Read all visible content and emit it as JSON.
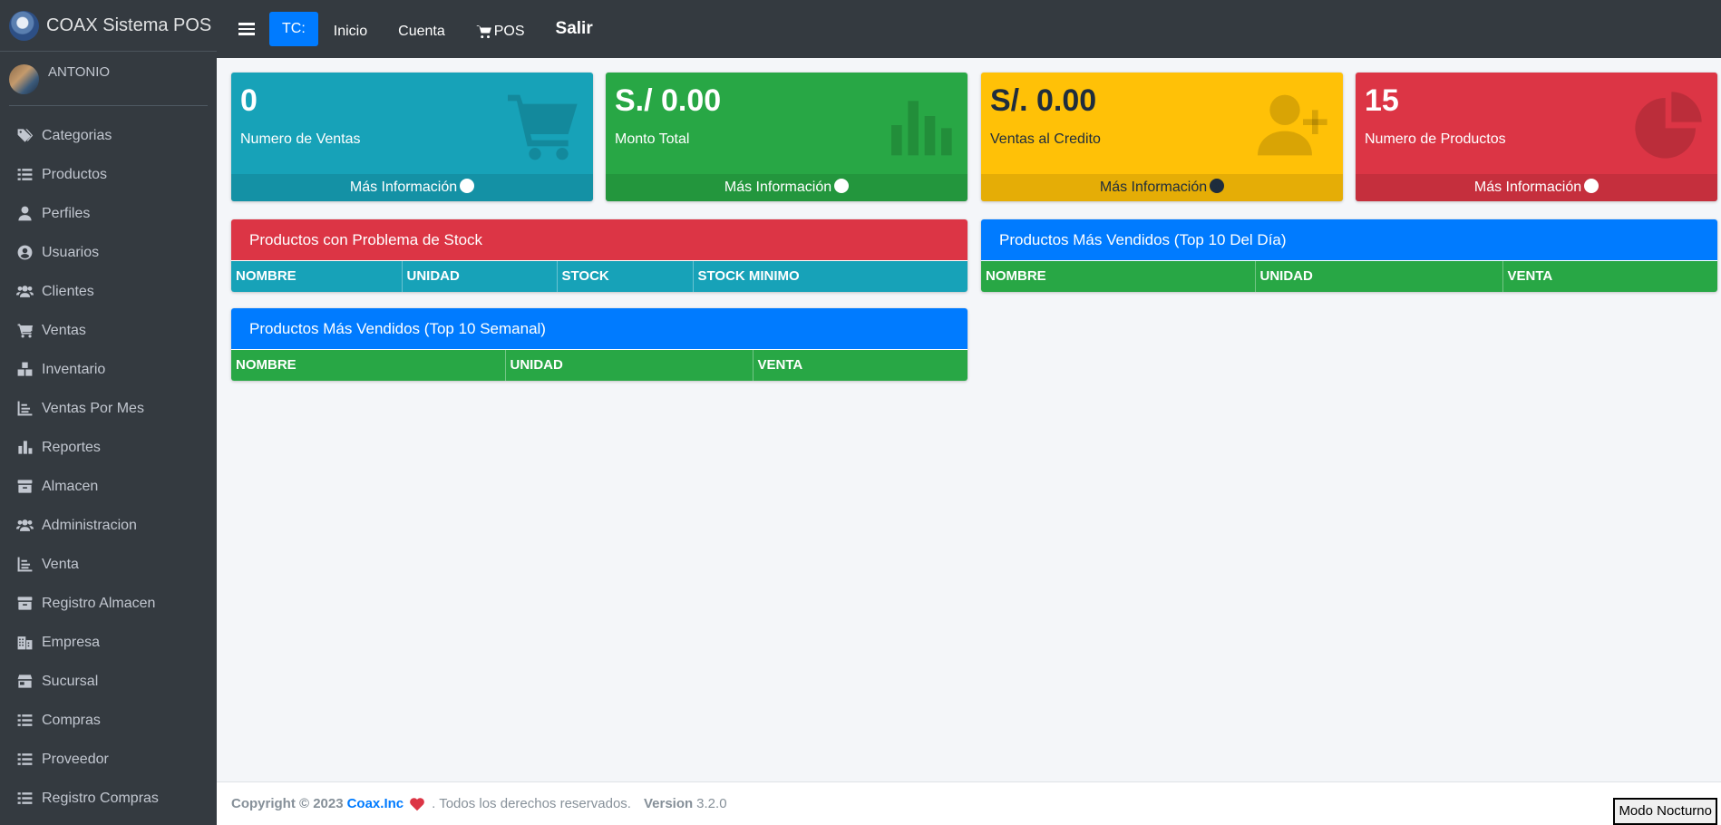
{
  "brand": {
    "name": "COAX Sistema POS",
    "logo_icon": "coax-logo"
  },
  "user": {
    "name": "ANTONIO"
  },
  "sidebar": {
    "items": [
      {
        "label": "Categorias",
        "icon": "tags-icon"
      },
      {
        "label": "Productos",
        "icon": "list-icon"
      },
      {
        "label": "Perfiles",
        "icon": "user-tie-icon"
      },
      {
        "label": "Usuarios",
        "icon": "user-circle-icon"
      },
      {
        "label": "Clientes",
        "icon": "users-icon"
      },
      {
        "label": "Ventas",
        "icon": "cart-plus-icon"
      },
      {
        "label": "Inventario",
        "icon": "cubes-icon"
      },
      {
        "label": "Ventas Por Mes",
        "icon": "chart-line-icon"
      },
      {
        "label": "Reportes",
        "icon": "chart-bar-icon"
      },
      {
        "label": "Almacen",
        "icon": "archive-icon"
      },
      {
        "label": "Administracion",
        "icon": "users-cog-icon"
      },
      {
        "label": "Venta",
        "icon": "chart-line-icon"
      },
      {
        "label": "Registro Almacen",
        "icon": "archive-icon"
      },
      {
        "label": "Empresa",
        "icon": "building-icon"
      },
      {
        "label": "Sucursal",
        "icon": "store-icon"
      },
      {
        "label": "Compras",
        "icon": "list-icon"
      },
      {
        "label": "Proveedor",
        "icon": "list-icon"
      },
      {
        "label": "Registro Compras",
        "icon": "list-icon"
      }
    ]
  },
  "navbar": {
    "tc_label": "TC:",
    "inicio": "Inicio",
    "cuenta": "Cuenta",
    "pos": "POS",
    "salir": "Salir"
  },
  "info_boxes": [
    {
      "value": "0",
      "label": "Numero de Ventas",
      "link": "Más Información",
      "icon": "shopping-cart-icon",
      "color": "#17a2b8"
    },
    {
      "value": "S./ 0.00",
      "label": "Monto Total",
      "link": "Más Información",
      "icon": "bar-chart-icon",
      "color": "#28a745"
    },
    {
      "value": "S/. 0.00",
      "label": "Ventas al Credito",
      "link": "Más Información",
      "icon": "user-plus-icon",
      "color": "#ffc107"
    },
    {
      "value": "15",
      "label": "Numero de Productos",
      "link": "Más Información",
      "icon": "pie-chart-icon",
      "color": "#dc3545"
    }
  ],
  "cards": {
    "stock": {
      "title": "Productos con Problema de Stock",
      "columns": [
        "NOMBRE",
        "UNIDAD",
        "STOCK",
        "STOCK MINIMO"
      ]
    },
    "top_day": {
      "title": "Productos Más Vendidos (Top 10 Del Día)",
      "columns": [
        "NOMBRE",
        "UNIDAD",
        "VENTA"
      ]
    },
    "top_week": {
      "title": "Productos Más Vendidos (Top 10 Semanal)",
      "columns": [
        "NOMBRE",
        "UNIDAD",
        "VENTA"
      ]
    }
  },
  "footer": {
    "copyright": "Copyright © 2023",
    "company": "Coax.Inc",
    "rights": ". Todos los derechos reservados.",
    "version_label": "Version",
    "version": "3.2.0",
    "night_mode": "Modo Nocturno"
  }
}
